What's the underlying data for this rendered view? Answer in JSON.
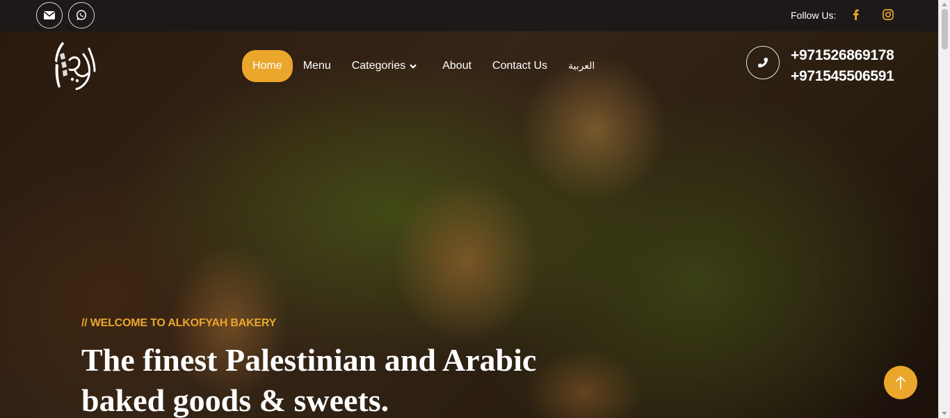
{
  "topbar": {
    "email_icon": "envelope-icon",
    "whatsapp_icon": "whatsapp-icon",
    "follow_label": "Follow Us:",
    "facebook_icon": "facebook-icon",
    "instagram_icon": "instagram-icon"
  },
  "header": {
    "logo_text": "الكوفية",
    "nav": [
      {
        "label": "Home",
        "active": true
      },
      {
        "label": "Menu"
      },
      {
        "label": "Categories",
        "has_dropdown": true
      },
      {
        "label": "About"
      },
      {
        "label": "Contact Us"
      },
      {
        "label": "العربية"
      }
    ],
    "phone_icon": "phone-icon",
    "phones": [
      "+971526869178",
      "+971545506591"
    ]
  },
  "hero": {
    "kicker": "// WELCOME TO ALKOFYAH BAKERY",
    "headline_line1": "The finest Palestinian and Arabic",
    "headline_line2": "baked goods & sweets."
  },
  "scroll_top_icon": "arrow-up-icon",
  "colors": {
    "accent": "#eba62c",
    "topbar_bg": "#1d1919",
    "facebook": "#eba62c",
    "instagram": "#eba62c"
  }
}
